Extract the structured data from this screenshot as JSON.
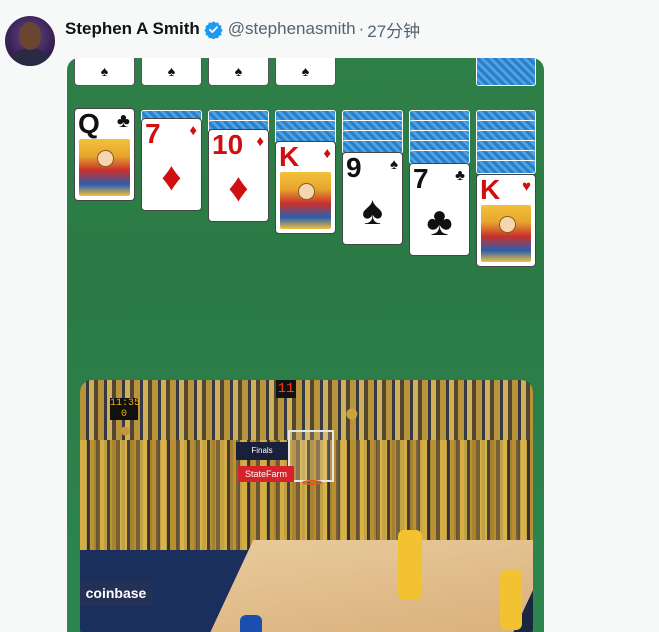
{
  "author": {
    "display_name": "Stephen A Smith",
    "handle": "@stephenasmith",
    "separator": "·",
    "timestamp": "27分钟",
    "verified_icon": "verified-badge-icon"
  },
  "solitaire": {
    "foundation_suits": [
      "♠",
      "♠",
      "♠",
      "♠"
    ],
    "columns": [
      {
        "rank": "Q",
        "suit": "♣",
        "color": "black",
        "face_card": true
      },
      {
        "rank": "7",
        "suit": "♦",
        "color": "red",
        "face_card": false
      },
      {
        "rank": "10",
        "suit": "♦",
        "color": "red",
        "face_card": false
      },
      {
        "rank": "K",
        "suit": "♦",
        "color": "red",
        "face_card": true
      },
      {
        "rank": "9",
        "suit": "♠",
        "color": "black",
        "face_card": false
      },
      {
        "rank": "7",
        "suit": "♣",
        "color": "black",
        "face_card": false
      },
      {
        "rank": "K",
        "suit": "♥",
        "color": "red",
        "face_card": true
      }
    ],
    "hidden_counts": [
      0,
      1,
      2,
      3,
      4,
      5,
      6
    ]
  },
  "video": {
    "shot_clock": "11:35\n0",
    "game_clock": "11",
    "banner_text": "Finals",
    "sponsor_1": "StateFarm",
    "sponsor_2": "coinbase"
  },
  "colors": {
    "felt": "#2d7f49",
    "card_back": "#3b8fd6",
    "red_suit": "#d01010",
    "verified": "#1d9bf0"
  }
}
